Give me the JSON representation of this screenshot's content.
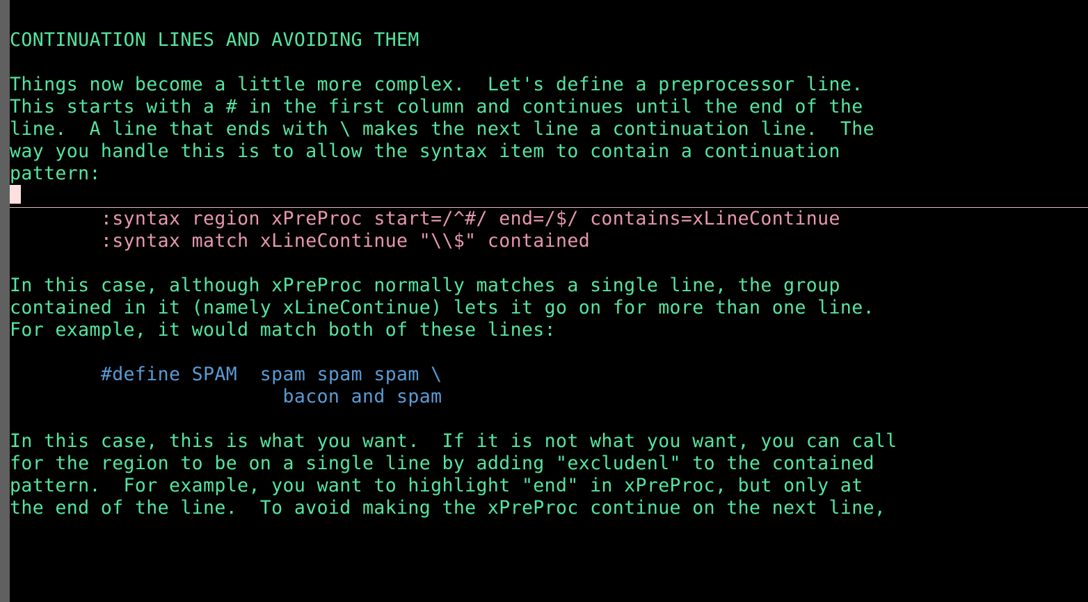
{
  "colors": {
    "background": "#000000",
    "text_green": "#55e5a0",
    "text_pink": "#e797b0",
    "text_blue": "#5a9bd4",
    "scrollbar": "#606060",
    "cursor_bg": "#ffe0e0",
    "rule": "#e6b8c0"
  },
  "heading": "CONTINUATION LINES AND AVOIDING THEM",
  "para1": {
    "l1": "Things now become a little more complex.  Let's define a preprocessor line.",
    "l2": "This starts with a # in the first column and continues until the end of the",
    "l3": "line.  A line that ends with \\ makes the next line a continuation line.  The",
    "l4": "way you handle this is to allow the syntax item to contain a continuation",
    "l5": "pattern:"
  },
  "code1": {
    "l1": "        :syntax region xPreProc start=/^#/ end=/$/ contains=xLineContinue",
    "l2": "        :syntax match xLineContinue \"\\\\$\" contained"
  },
  "para2": {
    "l1": "In this case, although xPreProc normally matches a single line, the group",
    "l2": "contained in it (namely xLineContinue) lets it go on for more than one line.",
    "l3": "For example, it would match both of these lines:"
  },
  "code2": {
    "l1": "        #define SPAM  spam spam spam \\",
    "l2": "                        bacon and spam"
  },
  "para3": {
    "l1": "In this case, this is what you want.  If it is not what you want, you can call",
    "l2": "for the region to be on a single line by adding \"excludenl\" to the contained",
    "l3": "pattern.  For example, you want to highlight \"end\" in xPreProc, but only at",
    "l4": "the end of the line.  To avoid making the xPreProc continue on the next line,"
  }
}
